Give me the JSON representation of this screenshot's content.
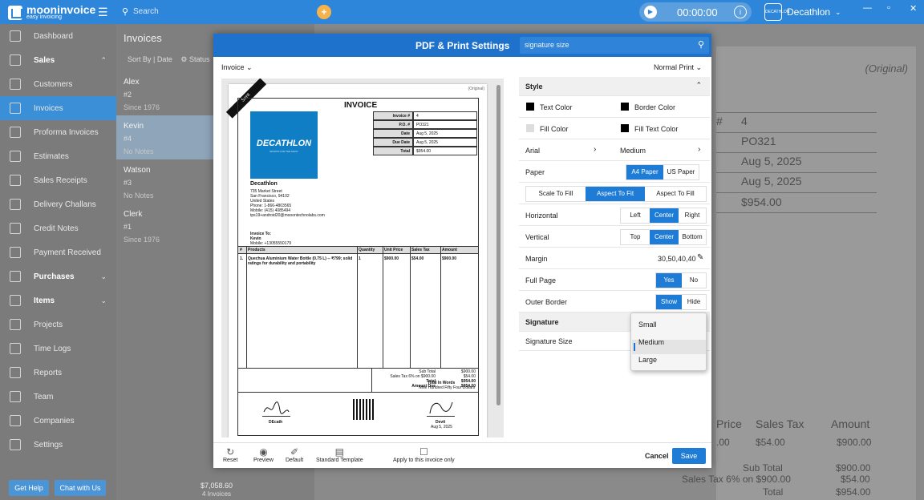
{
  "app": {
    "name": "mooninvoice",
    "tagline": "easy invoicing",
    "search_placeholder": "Search",
    "timer": "00:00:00",
    "company": "Decathlon",
    "company_logo_text": "DECATHLON"
  },
  "sidebar": {
    "items": [
      {
        "label": "Dashboard",
        "icon": "dashboard-icon"
      },
      {
        "label": "Sales",
        "icon": "sales-icon",
        "section": true,
        "chev": "⌃"
      },
      {
        "label": "Customers",
        "icon": "customers-icon"
      },
      {
        "label": "Invoices",
        "icon": "invoice-icon",
        "active": true
      },
      {
        "label": "Proforma Invoices",
        "icon": "proforma-icon"
      },
      {
        "label": "Estimates",
        "icon": "estimate-icon"
      },
      {
        "label": "Sales Receipts",
        "icon": "receipt-icon"
      },
      {
        "label": "Delivery Challans",
        "icon": "delivery-icon"
      },
      {
        "label": "Credit Notes",
        "icon": "credit-note-icon"
      },
      {
        "label": "Payment Received",
        "icon": "payment-icon"
      },
      {
        "label": "Purchases",
        "icon": "purchases-icon",
        "section": true,
        "chev": "⌄"
      },
      {
        "label": "Items",
        "icon": "items-icon",
        "section": true,
        "chev": "⌄"
      },
      {
        "label": "Projects",
        "icon": "projects-icon"
      },
      {
        "label": "Time Logs",
        "icon": "time-log-icon"
      },
      {
        "label": "Reports",
        "icon": "reports-icon"
      },
      {
        "label": "Team",
        "icon": "team-icon"
      },
      {
        "label": "Companies",
        "icon": "companies-icon"
      },
      {
        "label": "Settings",
        "icon": "settings-icon"
      }
    ],
    "sync": "Sync",
    "get_help": "Get Help",
    "chat": "Chat with Us"
  },
  "list": {
    "title": "Invoices",
    "sort": "Sort By | Date",
    "status": "Status",
    "customers": [
      {
        "name": "Alex",
        "num": "#2",
        "note": "Since 1976"
      },
      {
        "name": "Kevin",
        "num": "#4",
        "note": "No Notes",
        "selected": true
      },
      {
        "name": "Watson",
        "num": "#3",
        "note": "No Notes"
      },
      {
        "name": "Clerk",
        "num": "#1",
        "note": "Since 1976"
      }
    ],
    "total": "$7,058.60",
    "count": "4 Invoices"
  },
  "background_doc": {
    "original": "(Original)",
    "hash": "#",
    "num": "4",
    "po": "PO321",
    "date1": "Aug 5, 2025",
    "date2": "Aug 5, 2025",
    "total": "$954.00",
    "col_price": "Price",
    "col_tax": "Sales Tax",
    "col_amount": "Amount",
    "row_price": ".00",
    "row_tax": "$54.00",
    "row_amount": "$900.00",
    "sub_label": "Sub Total",
    "sub_val": "$900.00",
    "tax_label": "Sales Tax 6% on $900.00",
    "tax_val": "$54.00",
    "tot_label": "Total",
    "tot_val": "$954.00"
  },
  "modal": {
    "title": "PDF & Print Settings",
    "search_value": "signature size",
    "doc_type": "Invoice",
    "print_mode": "Normal Print",
    "preview": {
      "sent": "Sent",
      "original": "(Original)",
      "title": "INVOICE",
      "logo": "DECATHLON",
      "logo_sub": "SPORTS FOR THE MANY",
      "meta": [
        [
          "Invoice #",
          "4"
        ],
        [
          "P.O. #",
          "PO321"
        ],
        [
          "Date",
          "Aug 5, 2025"
        ],
        [
          "Due Date",
          "Aug 5, 2025"
        ],
        [
          "Total",
          "$954.00"
        ]
      ],
      "company": "Decathlon",
      "address": [
        "735 Market Street",
        "San Francisco, 94102",
        "United States",
        "Phone: 1-866-4803565",
        "Mobile: (415) 4085494",
        "tps19+android20@mooontechnolabs.com"
      ],
      "invoice_to": "Invoice To:",
      "customer": "Kevin",
      "customer_mobile": "Mobile: +13055550179",
      "cols": [
        "#",
        "Products",
        "Quantity",
        "Unit Price",
        "Sales Tax",
        "Amount"
      ],
      "item": {
        "no": "1.",
        "name": "Quechua Aluminium Water Bottle (0.75 L) -- ₹799; solid ratings for durability and portability",
        "qty": "1",
        "price": "$900.00",
        "tax": "$54.00",
        "amount": "$900.00"
      },
      "totals": [
        [
          "Sub Total",
          "$900.00"
        ],
        [
          "Sales Tax 6% on $900.00",
          "$54.00"
        ],
        [
          "Total",
          "$954.00"
        ],
        [
          "Amount Due",
          "$954.00"
        ]
      ],
      "words_label": "Total In Words",
      "words": "Nine Hundred Fifty Four Dollars",
      "sign_left": "DEcath",
      "sign_right": "Devit",
      "sign_date": "Aug 5, 2025"
    },
    "style": {
      "header": "Style",
      "text_color": "Text Color",
      "border_color": "Border Color",
      "fill_color": "Fill Color",
      "fill_text_color": "Fill Text Color",
      "font": "Arial",
      "weight": "Medium",
      "paper_label": "Paper",
      "paper_opts": [
        "A4 Paper",
        "US Paper"
      ],
      "fit_opts": [
        "Scale To Fill",
        "Aspect To Fit",
        "Aspect To Fill"
      ],
      "horizontal": "Horizontal",
      "h_opts": [
        "Left",
        "Center",
        "Right"
      ],
      "vertical": "Vertical",
      "v_opts": [
        "Top",
        "Center",
        "Bottom"
      ],
      "margin": "Margin",
      "margin_val": "30,50,40,40",
      "full_page": "Full Page",
      "fp_opts": [
        "Yes",
        "No"
      ],
      "outer_border": "Outer Border",
      "ob_opts": [
        "Show",
        "Hide"
      ]
    },
    "signature": {
      "header": "Signature",
      "size_label": "Signature Size",
      "options": [
        "Small",
        "Medium",
        "Large"
      ],
      "selected": "Medium"
    },
    "footer": {
      "reset": "Reset",
      "preview": "Preview",
      "default": "Default",
      "standard": "Standard Template",
      "apply": "Apply to this invoice only",
      "cancel": "Cancel",
      "save": "Save"
    }
  },
  "colors": {
    "accent": "#1e72cc",
    "topbar": "#2d86d9"
  }
}
